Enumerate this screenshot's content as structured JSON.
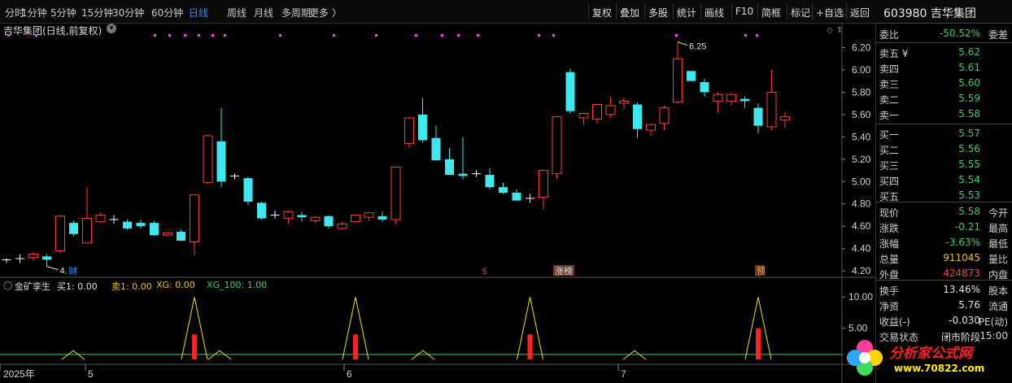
{
  "toolbar": {
    "periods": [
      "分时",
      "1分钟",
      "5分钟",
      "15分钟",
      "30分钟",
      "60分钟",
      "日线",
      "周线",
      "月线",
      "多周期",
      "更多 〉"
    ],
    "active_period": "日线",
    "actions": [
      "复权",
      "叠加",
      "多股",
      "统计",
      "画线",
      "F10",
      "简框",
      "标记",
      "+自选",
      "返回"
    ]
  },
  "stock": {
    "code": "603980",
    "name": "吉华集团",
    "title": "吉华集团(日线,前复权)"
  },
  "price_axis": {
    "ticks": [
      "6.20",
      "6.00",
      "5.80",
      "5.60",
      "5.40",
      "5.20",
      "5.00",
      "4.80",
      "4.60",
      "4.40",
      "4.20"
    ]
  },
  "annotations": {
    "high_label": "6.25",
    "low_label": "4.24",
    "events": [
      "财",
      "$",
      "涨榜",
      "预"
    ]
  },
  "indicator": {
    "name": "金矿孪生",
    "buy": "买1: 0.00",
    "sell": "卖1: 0.00",
    "xg": "XG: 0.00",
    "xg100": "XG_100: 1.00",
    "ticks": [
      "10.00",
      "5.00"
    ]
  },
  "time_axis": [
    "2025年",
    "5",
    "6",
    "7"
  ],
  "quote": {
    "weibi": {
      "label": "委比",
      "value": "-50.52%",
      "label2": "委差"
    },
    "sell": [
      {
        "label": "卖五 ¥",
        "price": "5.62"
      },
      {
        "label": "卖四",
        "price": "5.61"
      },
      {
        "label": "卖三",
        "price": "5.60"
      },
      {
        "label": "卖二",
        "price": "5.59"
      },
      {
        "label": "卖一",
        "price": "5.58"
      }
    ],
    "buy": [
      {
        "label": "买一",
        "price": "5.57"
      },
      {
        "label": "买二",
        "price": "5.56"
      },
      {
        "label": "买三",
        "price": "5.55"
      },
      {
        "label": "买四",
        "price": "5.54"
      },
      {
        "label": "买五",
        "price": "5.53"
      }
    ],
    "stats": [
      {
        "label": "现价",
        "value": "5.58",
        "label2": "今开",
        "color": "#3ecf6a"
      },
      {
        "label": "涨跌",
        "value": "-0.21",
        "label2": "最高",
        "color": "#3ecf6a"
      },
      {
        "label": "涨幅",
        "value": "-3.63%",
        "label2": "最低",
        "color": "#3ecf6a"
      },
      {
        "label": "总量",
        "value": "911045",
        "label2": "量比",
        "color": "#e8c020"
      },
      {
        "label": "外盘",
        "value": "424873",
        "label2": "内盘",
        "color": "#ff4040"
      }
    ],
    "stats2": [
      {
        "label": "换手",
        "value": "13.46%",
        "label2": "股本"
      },
      {
        "label": "净资",
        "value": "5.76",
        "label2": "流通"
      },
      {
        "label": "收益(-)",
        "value": "-0.030",
        "label2": "PE(动)"
      },
      {
        "label": "交易状态",
        "value": "闭市阶段",
        "label2": "15:00"
      }
    ]
  },
  "watermark": {
    "site": "分析家公式网",
    "url": "www.70822.com"
  },
  "colors": {
    "up": "#ff3d3d",
    "down": "#3fe8f0",
    "bg": "#000000",
    "active": "#1e90ff",
    "green": "#3ecf6a"
  },
  "chart_data": {
    "type": "candlestick",
    "ylim": [
      4.15,
      6.32
    ],
    "candles": [
      [
        4.29,
        4.31,
        4.27,
        4.3
      ],
      [
        4.31,
        4.35,
        4.27,
        4.31
      ],
      [
        4.32,
        4.37,
        4.29,
        4.35
      ],
      [
        4.33,
        4.35,
        4.24,
        4.3
      ],
      [
        4.38,
        4.7,
        4.36,
        4.69
      ],
      [
        4.63,
        4.65,
        4.51,
        4.53
      ],
      [
        4.45,
        4.95,
        4.45,
        4.67
      ],
      [
        4.64,
        4.72,
        4.63,
        4.7
      ],
      [
        4.66,
        4.7,
        4.62,
        4.66
      ],
      [
        4.64,
        4.66,
        4.57,
        4.58
      ],
      [
        4.63,
        4.66,
        4.58,
        4.6
      ],
      [
        4.63,
        4.65,
        4.51,
        4.52
      ],
      [
        4.52,
        4.54,
        4.51,
        4.54
      ],
      [
        4.55,
        4.57,
        4.49,
        4.47
      ],
      [
        4.46,
        4.88,
        4.34,
        4.88
      ],
      [
        4.99,
        5.42,
        4.98,
        5.41
      ],
      [
        5.36,
        5.66,
        4.95,
        5.0
      ],
      [
        5.04,
        5.07,
        5.02,
        5.05
      ],
      [
        5.03,
        5.04,
        4.79,
        4.82
      ],
      [
        4.81,
        4.82,
        4.66,
        4.67
      ],
      [
        4.7,
        4.74,
        4.67,
        4.7
      ],
      [
        4.67,
        4.74,
        4.62,
        4.73
      ],
      [
        4.7,
        4.73,
        4.64,
        4.68
      ],
      [
        4.65,
        4.69,
        4.63,
        4.68
      ],
      [
        4.69,
        4.7,
        4.58,
        4.6
      ],
      [
        4.58,
        4.64,
        4.57,
        4.62
      ],
      [
        4.64,
        4.7,
        4.63,
        4.7
      ],
      [
        4.68,
        4.73,
        4.65,
        4.72
      ],
      [
        4.69,
        4.73,
        4.64,
        4.66
      ],
      [
        4.66,
        5.13,
        4.62,
        5.13
      ],
      [
        5.34,
        5.58,
        5.3,
        5.57
      ],
      [
        5.6,
        5.75,
        5.35,
        5.37
      ],
      [
        5.39,
        5.5,
        5.36,
        5.19
      ],
      [
        5.2,
        5.3,
        5.08,
        5.06
      ],
      [
        5.07,
        5.4,
        5.02,
        5.05
      ],
      [
        5.07,
        5.1,
        5.04,
        5.07
      ],
      [
        5.06,
        5.12,
        4.93,
        4.95
      ],
      [
        4.95,
        4.99,
        4.89,
        4.9
      ],
      [
        4.9,
        4.93,
        4.86,
        4.83
      ],
      [
        4.84,
        4.89,
        4.81,
        4.85
      ],
      [
        4.86,
        5.11,
        4.75,
        5.1
      ],
      [
        5.07,
        5.58,
        5.02,
        5.58
      ],
      [
        5.98,
        6.01,
        5.61,
        5.63
      ],
      [
        5.57,
        5.62,
        5.51,
        5.61
      ],
      [
        5.56,
        5.68,
        5.52,
        5.69
      ],
      [
        5.6,
        5.76,
        5.57,
        5.68
      ],
      [
        5.7,
        5.75,
        5.65,
        5.72
      ],
      [
        5.69,
        5.71,
        5.39,
        5.47
      ],
      [
        5.46,
        5.52,
        5.41,
        5.51
      ],
      [
        5.52,
        5.68,
        5.46,
        5.66
      ],
      [
        5.71,
        6.25,
        5.7,
        6.1
      ],
      [
        5.99,
        5.99,
        5.91,
        5.9
      ],
      [
        5.89,
        5.92,
        5.76,
        5.8
      ],
      [
        5.72,
        5.8,
        5.62,
        5.78
      ],
      [
        5.72,
        5.79,
        5.68,
        5.78
      ],
      [
        5.74,
        5.76,
        5.66,
        5.72
      ],
      [
        5.66,
        5.7,
        5.43,
        5.5
      ],
      [
        5.49,
        6.0,
        5.46,
        5.8
      ],
      [
        5.55,
        5.62,
        5.48,
        5.58
      ]
    ],
    "signals": [
      {
        "index": 14,
        "value": 4.0
      },
      {
        "index": 26,
        "value": 4.0
      },
      {
        "index": 39,
        "value": 4.0
      },
      {
        "index": 56,
        "value": 5.0
      }
    ],
    "tri_peak": 10.0
  }
}
